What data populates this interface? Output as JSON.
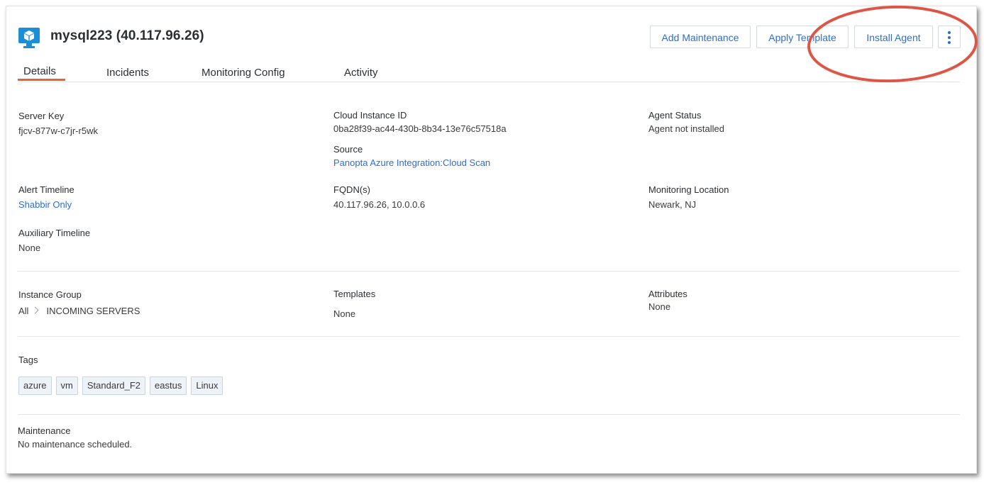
{
  "header": {
    "title": "mysql223 (40.117.96.26)",
    "icon": "server-cube-icon"
  },
  "actions": {
    "add_maintenance": "Add Maintenance",
    "apply_template": "Apply Template",
    "install_agent": "Install Agent",
    "more_icon": "kebab-menu-icon"
  },
  "tabs": [
    {
      "label": "Details",
      "active": true
    },
    {
      "label": "Incidents",
      "active": false
    },
    {
      "label": "Monitoring Config",
      "active": false
    },
    {
      "label": "Activity",
      "active": false
    }
  ],
  "details": {
    "server_key": {
      "label": "Server Key",
      "value": "fjcv-877w-c7jr-r5wk"
    },
    "cloud_instance_id": {
      "label": "Cloud Instance ID",
      "value": "0ba28f39-ac44-430b-8b34-13e76c57518a"
    },
    "agent_status": {
      "label": "Agent Status",
      "value": "Agent not installed"
    },
    "source": {
      "label": "Source",
      "value": "Panopta Azure Integration:Cloud Scan"
    },
    "alert_timeline": {
      "label": "Alert Timeline",
      "value": "Shabbir Only"
    },
    "fqdns": {
      "label": "FQDN(s)",
      "value": "40.117.96.26, 10.0.0.6"
    },
    "monitoring_location": {
      "label": "Monitoring Location",
      "value": "Newark, NJ"
    },
    "auxiliary_timeline": {
      "label": "Auxiliary Timeline",
      "value": "None"
    },
    "instance_group": {
      "label": "Instance Group",
      "root": "All",
      "group": "INCOMING SERVERS"
    },
    "templates": {
      "label": "Templates",
      "value": "None"
    },
    "attributes": {
      "label": "Attributes",
      "value": "None"
    },
    "tags": {
      "label": "Tags",
      "items": [
        "azure",
        "vm",
        "Standard_F2",
        "eastus",
        "Linux"
      ]
    },
    "maintenance": {
      "label": "Maintenance",
      "value": "No maintenance scheduled."
    }
  },
  "colors": {
    "accent_link": "#2e6ec9",
    "tab_active_underline": "#e8642c",
    "annotation_ring": "#e05a4b",
    "icon_blue": "#1a8fd6"
  }
}
